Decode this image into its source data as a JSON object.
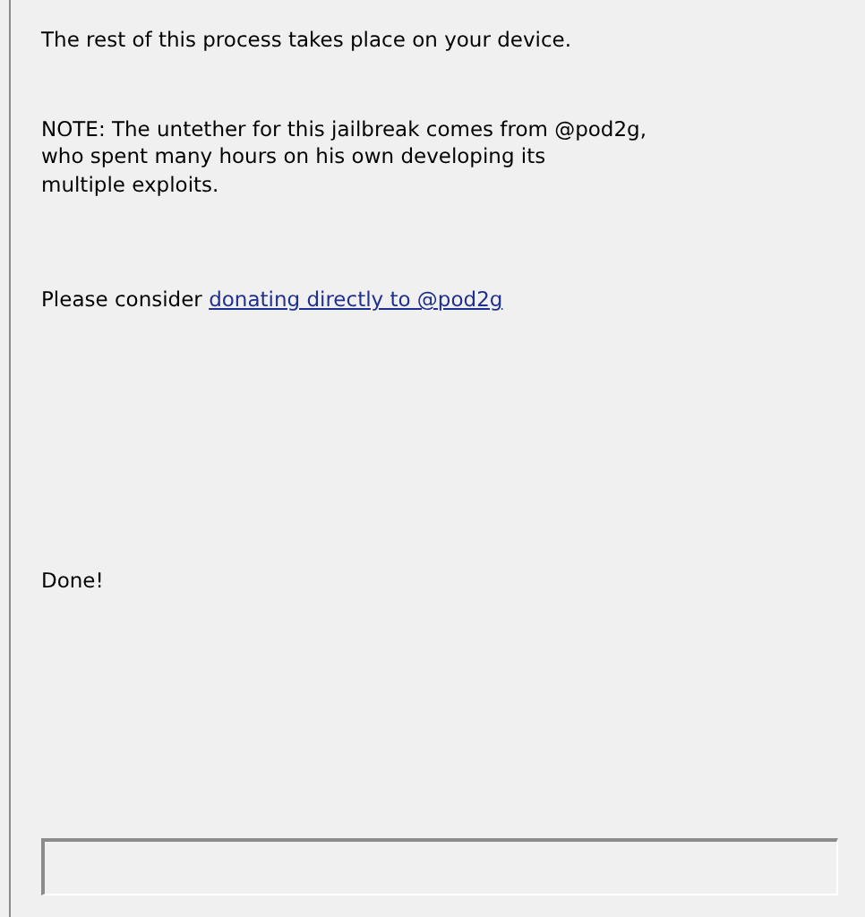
{
  "messages": [
    {
      "text": "The rest of this process takes place on your device."
    },
    {
      "text": "NOTE: The untether for this jailbreak comes from @pod2g,\nwho spent many hours on his own developing its\nmultiple exploits."
    }
  ],
  "donate": {
    "text": "Please consider ",
    "link": "donating directly to @pod2g"
  },
  "status": "Done!",
  "progress": {
    "level": 0
  }
}
